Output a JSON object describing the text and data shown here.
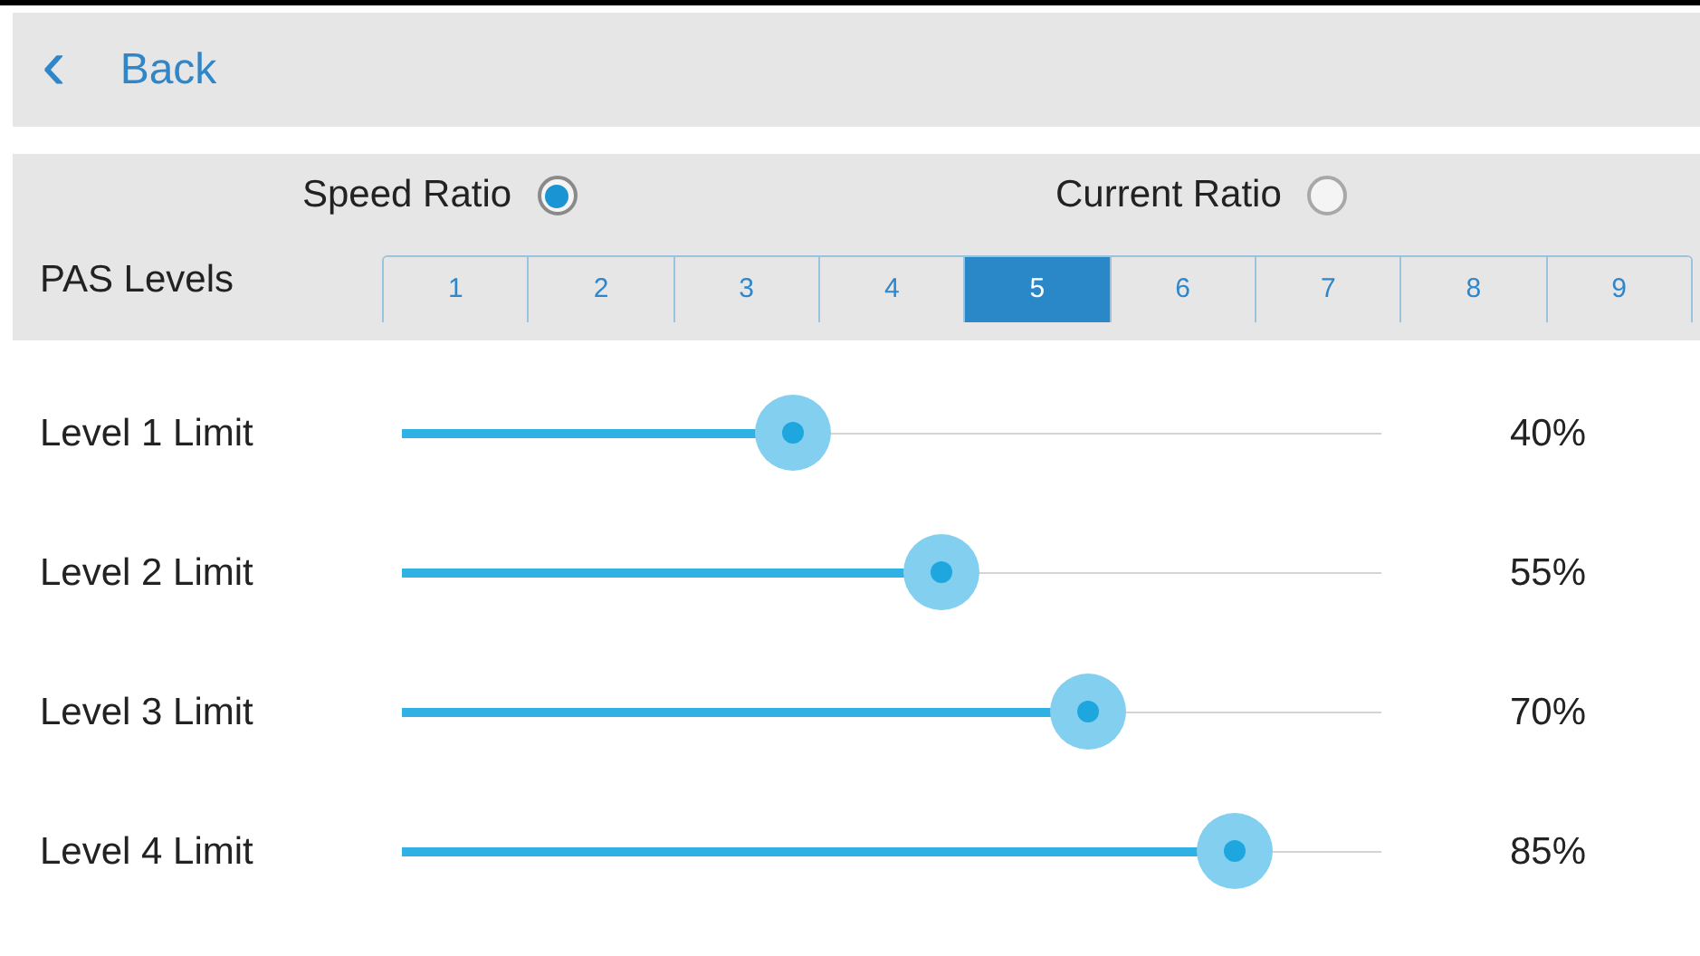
{
  "header": {
    "back_icon": "‹",
    "back_label": "Back"
  },
  "ratio_options": [
    {
      "label": "Speed Ratio",
      "selected": true
    },
    {
      "label": "Current Ratio",
      "selected": false
    }
  ],
  "pas_levels": {
    "label": "PAS Levels",
    "options": [
      {
        "label": "1",
        "selected": false
      },
      {
        "label": "2",
        "selected": false
      },
      {
        "label": "3",
        "selected": false
      },
      {
        "label": "4",
        "selected": false
      },
      {
        "label": "5",
        "selected": true
      },
      {
        "label": "6",
        "selected": false
      },
      {
        "label": "7",
        "selected": false
      },
      {
        "label": "8",
        "selected": false
      },
      {
        "label": "9",
        "selected": false
      }
    ]
  },
  "sliders": [
    {
      "name": "Level 1 Limit",
      "level": 0.4,
      "reading": "40%"
    },
    {
      "name": "Level 2 Limit",
      "level": 0.55,
      "reading": "55%"
    },
    {
      "name": "Level 3 Limit",
      "level": 0.7,
      "reading": "70%"
    },
    {
      "name": "Level 4 Limit",
      "level": 0.85,
      "reading": "85%"
    }
  ]
}
